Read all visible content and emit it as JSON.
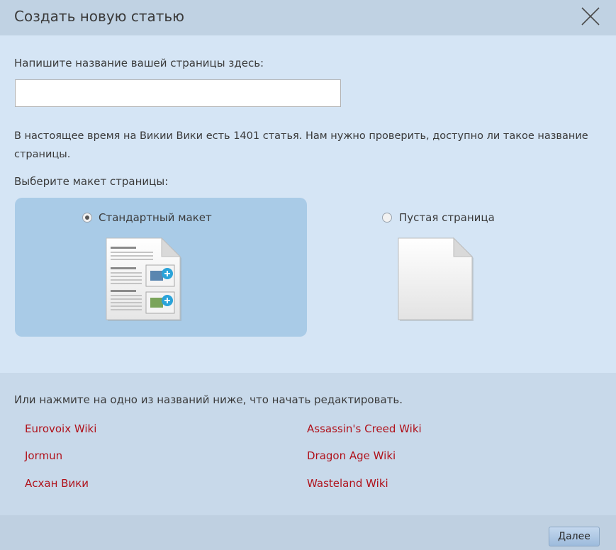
{
  "dialog": {
    "title": "Создать новую статью",
    "close_icon": "close-icon"
  },
  "form": {
    "name_label": "Напишите название вашей страницы здесь:",
    "name_value": "",
    "info_text": "В настоящее время на Викии Вики есть 1401 статья. Нам нужно проверить, доступно ли такое название страницы.",
    "layout_label": "Выберите макет страницы:",
    "layouts": [
      {
        "label": "Стандартный макет",
        "selected": true,
        "icon": "standard-layout-icon"
      },
      {
        "label": "Пустая страница",
        "selected": false,
        "icon": "blank-page-icon"
      }
    ]
  },
  "suggestions": {
    "label": "Или нажмите на одно из названий ниже, что начать редактировать.",
    "links": [
      "Eurovoix Wiki",
      "Assassin's Creed Wiki",
      "Jormun",
      "Dragon Age Wiki",
      "Асхан Вики",
      "Wasteland Wiki"
    ],
    "link_color": "#b0121b"
  },
  "footer": {
    "next_label": "Далее"
  },
  "colors": {
    "header_bg": "#c0d2e3",
    "body_bg": "#d5e5f5",
    "selected_layout_bg": "#a9cbe7",
    "suggestions_bg": "#c8d9ea"
  }
}
